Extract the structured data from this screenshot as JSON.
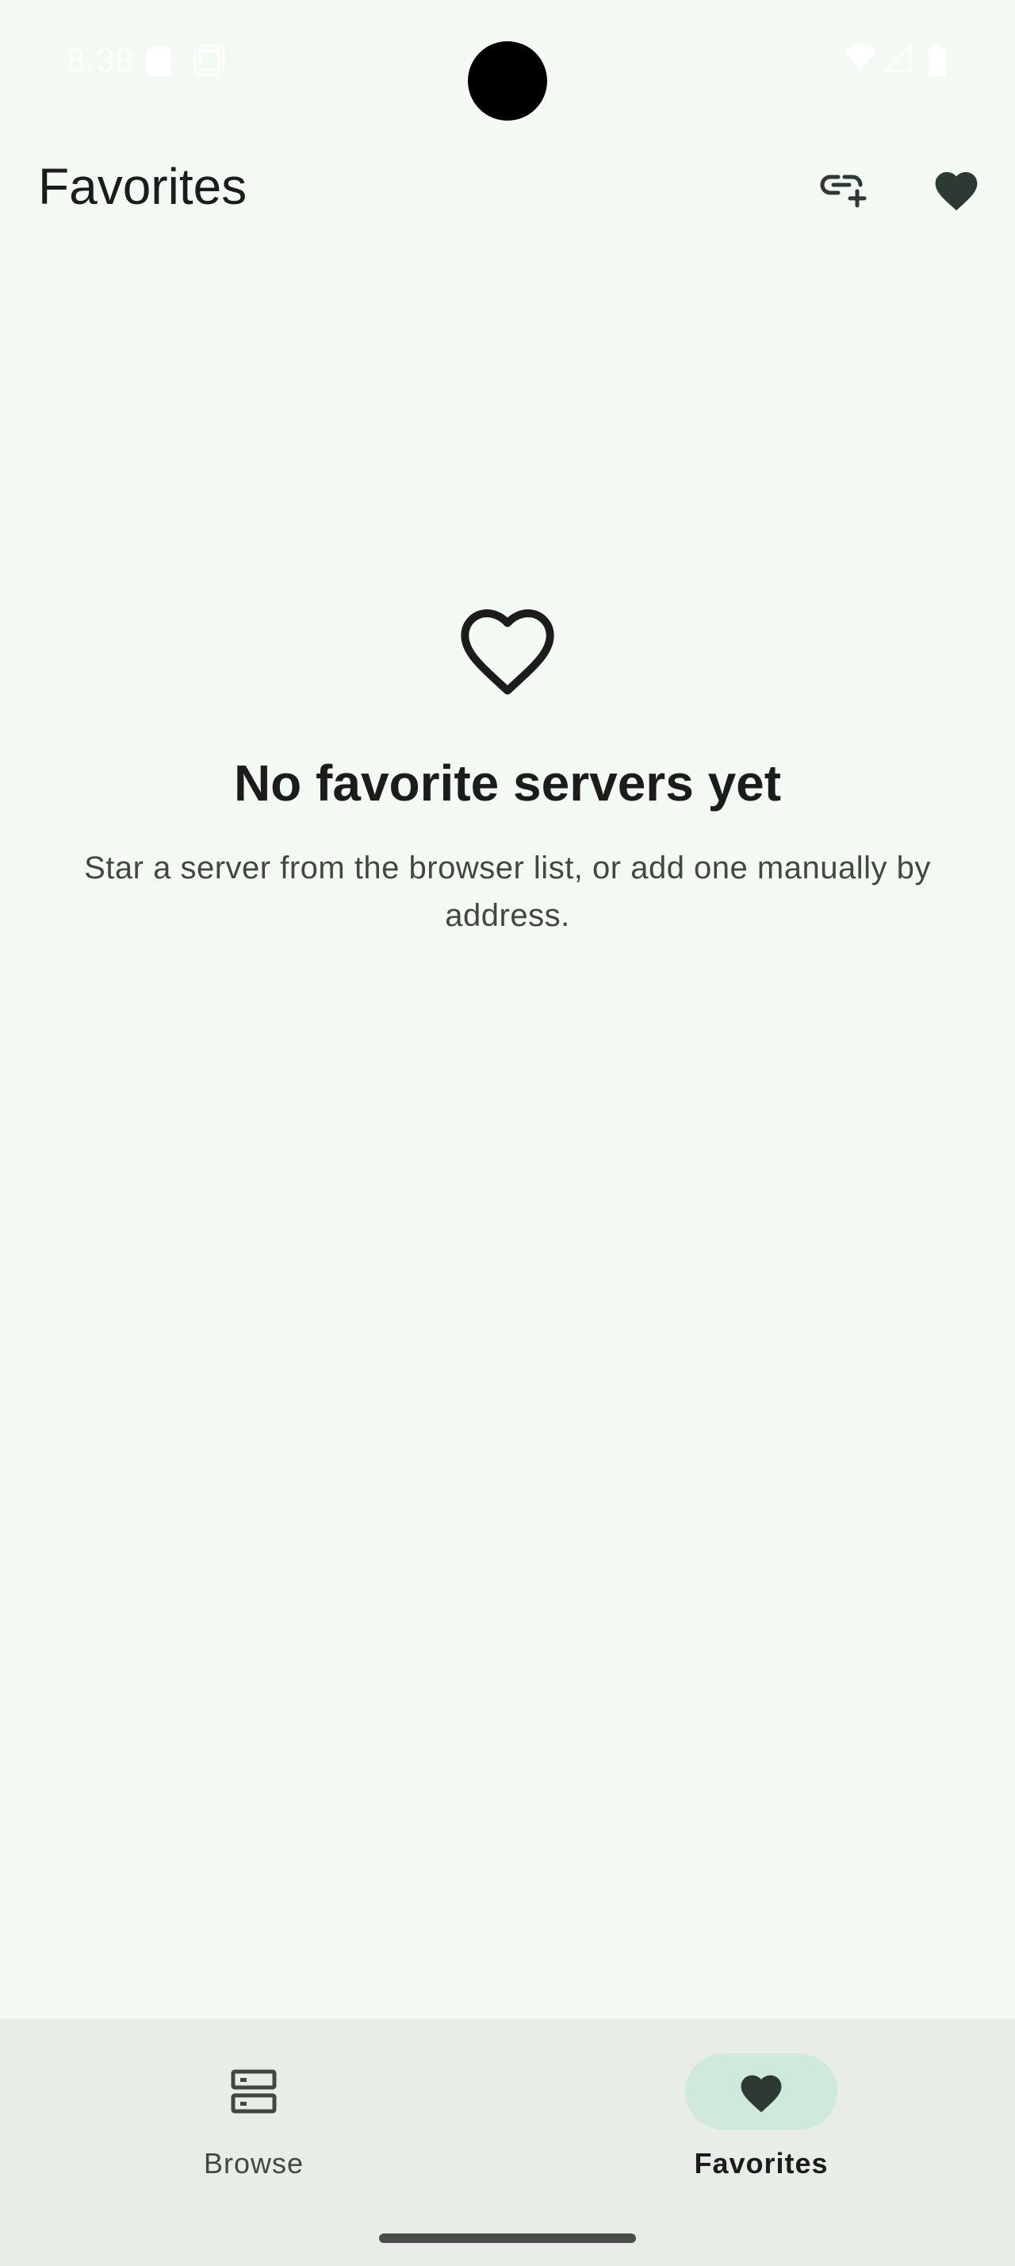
{
  "status_bar": {
    "time": "8:38"
  },
  "header": {
    "title": "Favorites",
    "actions": [
      {
        "icon": "link-add-icon"
      },
      {
        "icon": "heart-filled-icon"
      }
    ]
  },
  "empty_state": {
    "icon": "heart-outline-icon",
    "title": "No favorite servers yet",
    "description": "Star a server from the browser list, or add one manually by address."
  },
  "bottom_nav": {
    "items": [
      {
        "label": "Browse",
        "icon": "server-list-icon",
        "selected": false
      },
      {
        "label": "Favorites",
        "icon": "heart-filled-icon",
        "selected": true
      }
    ]
  },
  "colors": {
    "background": "#f3f9f3",
    "nav_background": "#e8ede8",
    "nav_active_indicator": "#cfe9dc",
    "icon_dark": "#2c3a33",
    "text_primary": "#1b1c1b",
    "text_secondary": "#414842"
  }
}
